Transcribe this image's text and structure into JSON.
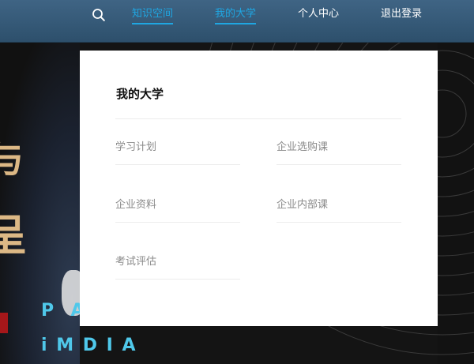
{
  "header": {
    "search_icon": "search-icon",
    "nav": [
      {
        "label": "知识空间",
        "active": true
      },
      {
        "label": "我的大学",
        "active": true
      },
      {
        "label": "个人中心",
        "active": false
      },
      {
        "label": "退出登录",
        "active": false
      }
    ],
    "accent_color": "#1fa6e2"
  },
  "background": {
    "glyphs": [
      "与",
      "呈"
    ],
    "shirt_text": "P  A\ni M D I A"
  },
  "panel": {
    "title": "我的大学",
    "links": [
      {
        "label": "学习计划"
      },
      {
        "label": "企业选购课"
      },
      {
        "label": "企业资料"
      },
      {
        "label": "企业内部课"
      },
      {
        "label": "考试评估"
      }
    ]
  }
}
